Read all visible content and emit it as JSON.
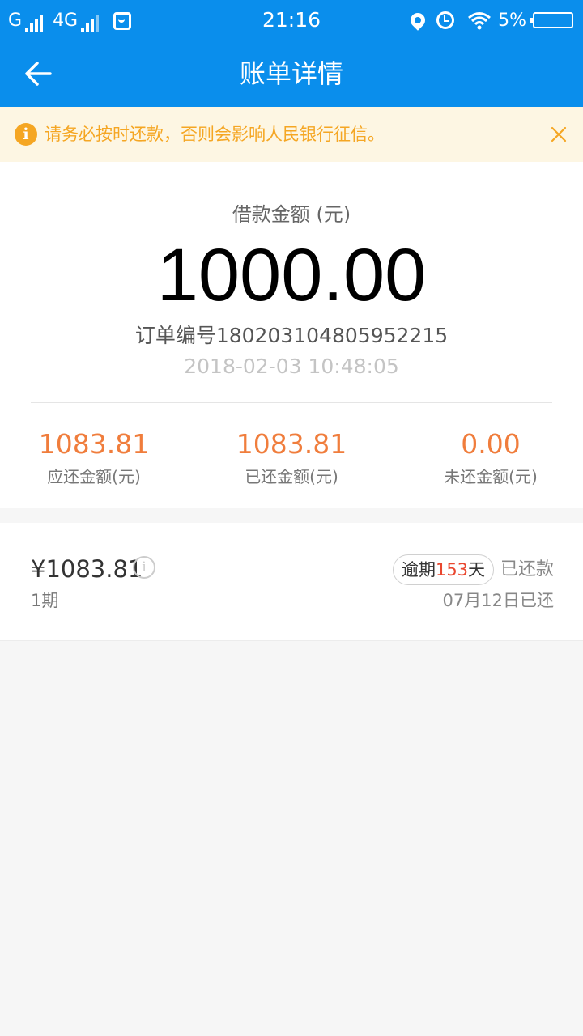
{
  "status_bar": {
    "network_1": "G",
    "network_2": "4G",
    "time": "21:16",
    "battery_text": "5%",
    "icons": [
      "signal-icon",
      "shopping-bag-icon",
      "location-pin-icon",
      "alarm-clock-icon",
      "wifi-icon",
      "battery-icon"
    ]
  },
  "nav": {
    "back_icon": "arrow-left-icon",
    "title": "账单详情"
  },
  "notice": {
    "icon": "info-icon",
    "text": "请务必按时还款，否则会影响人民银行征信。",
    "close_icon": "close-icon",
    "color": "#f5a623"
  },
  "summary": {
    "amount_label": "借款金额 (元)",
    "amount": "1000.00",
    "order_no": "订单编号180203104805952215",
    "order_time": "2018-02-03 10:48:05",
    "stats": [
      {
        "value": "1083.81",
        "label": "应还金额(元)"
      },
      {
        "value": "1083.81",
        "label": "已还金额(元)"
      },
      {
        "value": "0.00",
        "label": "未还金额(元)"
      }
    ],
    "accent_color": "#f07d3c"
  },
  "bill": {
    "amount": "¥1083.81",
    "period": "1期",
    "overdue_prefix": "逾期",
    "overdue_days": "153",
    "overdue_suffix": "天",
    "status": "已还款",
    "paid_date": "07月12日已还"
  },
  "theme": {
    "primary": "#0a8eec"
  }
}
